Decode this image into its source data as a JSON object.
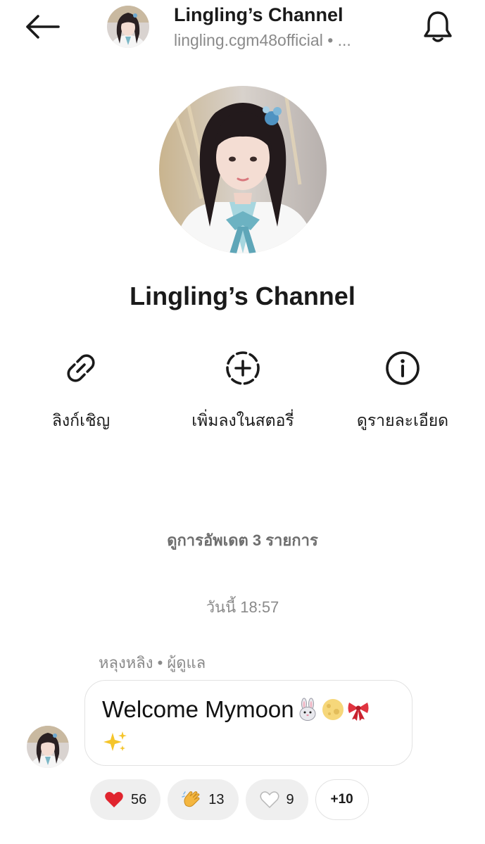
{
  "header": {
    "title": "Lingling’s Channel",
    "subtitle": "lingling.cgm48official • ...",
    "back_icon": "arrow-left-icon",
    "bell_icon": "bell-icon"
  },
  "profile": {
    "name": "Lingling’s Channel"
  },
  "actions": [
    {
      "icon": "link-icon",
      "label": "ลิงก์เชิญ"
    },
    {
      "icon": "add-story-icon",
      "label": "เพิ่มลงในสตอรี่"
    },
    {
      "icon": "info-icon",
      "label": "ดูรายละเอียด"
    }
  ],
  "updates": {
    "link_label": "ดูการอัพเดต 3 รายการ",
    "timestamp": "วันนี้ 18:57"
  },
  "message": {
    "sender": "หลุงหลิง • ผู้ดูแล",
    "text": "Welcome Mymoon",
    "emojis": [
      "rabbit-face-emoji",
      "full-moon-emoji",
      "ribbon-emoji",
      "sparkles-emoji"
    ],
    "reactions": [
      {
        "emoji": "red-heart-emoji",
        "count": "56"
      },
      {
        "emoji": "clapping-hands-emoji",
        "count": "13"
      },
      {
        "emoji": "white-heart-emoji",
        "count": "9"
      }
    ],
    "more_reactions": "+10"
  },
  "colors": {
    "text_primary": "#1a1a1a",
    "text_secondary": "#8a8a8a",
    "reaction_bg": "#efefef",
    "bubble_border": "#e2e2e2",
    "heart_red": "#e0242e",
    "clap_yellow": "#f4b63f"
  }
}
